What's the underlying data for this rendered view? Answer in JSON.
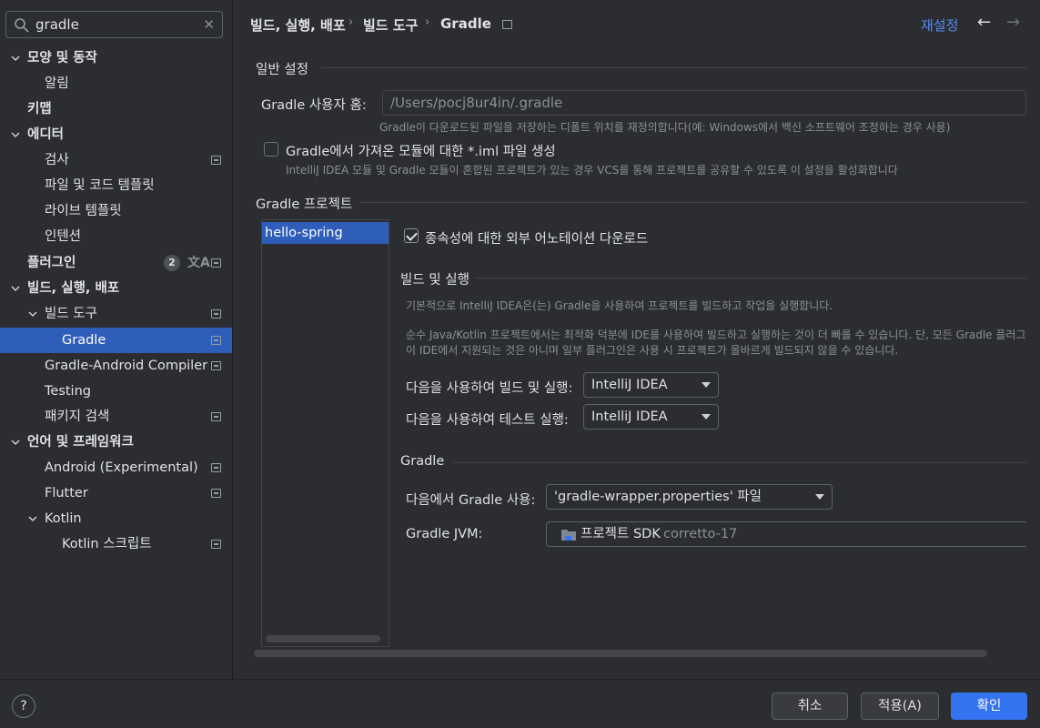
{
  "search": {
    "value": "gradle"
  },
  "sidebar": {
    "items": [
      {
        "label": "모양 및 동작"
      },
      {
        "label": "알림"
      },
      {
        "label": "키맵"
      },
      {
        "label": "에디터"
      },
      {
        "label": "검사"
      },
      {
        "label": "파일 및 코드 템플릿"
      },
      {
        "label": "라이브 템플릿"
      },
      {
        "label": "인텐션"
      },
      {
        "label": "플러그인",
        "badge": "2"
      },
      {
        "label": "빌드, 실행, 배포"
      },
      {
        "label": "빌드 도구"
      },
      {
        "label": "Gradle"
      },
      {
        "label": "Gradle-Android Compiler"
      },
      {
        "label": "Testing"
      },
      {
        "label": "패키지 검색"
      },
      {
        "label": "언어 및 프레임워크"
      },
      {
        "label": "Android (Experimental)"
      },
      {
        "label": "Flutter"
      },
      {
        "label": "Kotlin"
      },
      {
        "label": "Kotlin 스크립트"
      }
    ]
  },
  "breadcrumb": {
    "part1": "빌드, 실행, 배포",
    "part2": "빌드 도구",
    "part3": "Gradle"
  },
  "header": {
    "reset": "재설정"
  },
  "general": {
    "title": "일반 설정",
    "user_home_label": "Gradle 사용자 홈:",
    "user_home_value": "/Users/pocj8ur4in/.gradle",
    "user_home_hint": "Gradle이 다운로드된 파일을 저장하는 디폴트 위치를 재정의합니다(예: Windows에서 백신 소프트웨어 조정하는 경우 사용)",
    "iml_label": "Gradle에서 가져온 모듈에 대한 *.iml 파일 생성",
    "iml_hint": "IntelliJ IDEA 모듈 및 Gradle 모듈이 혼합된 프로젝트가 있는 경우 VCS를 통해 프로젝트를 공유할 수 있도록 이 설정을 활성화합니다"
  },
  "project": {
    "title": "Gradle 프로젝트",
    "list": [
      "hello-spring"
    ],
    "annotations_label": "종속성에 대한 외부 어노테이션 다운로드",
    "build_run_title": "빌드 및 실행",
    "build_desc1": "기본적으로 IntelliJ IDEA은(는) Gradle을 사용하여 프로젝트를 빌드하고 작업을 실행합니다.",
    "build_desc2": "순수 Java/Kotlin 프로젝트에서는 최적화 덕분에 IDE를 사용하여 빌드하고 실행하는 것이 더 빠를 수 있습니다. 단, 모든 Gradle 플러그",
    "build_desc3": "이 IDE에서 지원되는 것은 아니며 일부 플러그인은 사용 시 프로젝트가 올바르게 빌드되지 않을 수 있습니다.",
    "build_with_label": "다음을 사용하여 빌드 및 실행:",
    "build_with_value": "IntelliJ IDEA",
    "test_with_label": "다음을 사용하여 테스트 실행:",
    "test_with_value": "IntelliJ IDEA",
    "gradle_title": "Gradle",
    "use_gradle_label": "다음에서 Gradle 사용:",
    "use_gradle_value": "'gradle-wrapper.properties' 파일",
    "jvm_label": "Gradle JVM:",
    "jvm_value": "프로젝트 SDK",
    "jvm_detail": "corretto-17"
  },
  "footer": {
    "cancel": "취소",
    "apply": "적용(A)",
    "ok": "확인",
    "help": "?"
  }
}
